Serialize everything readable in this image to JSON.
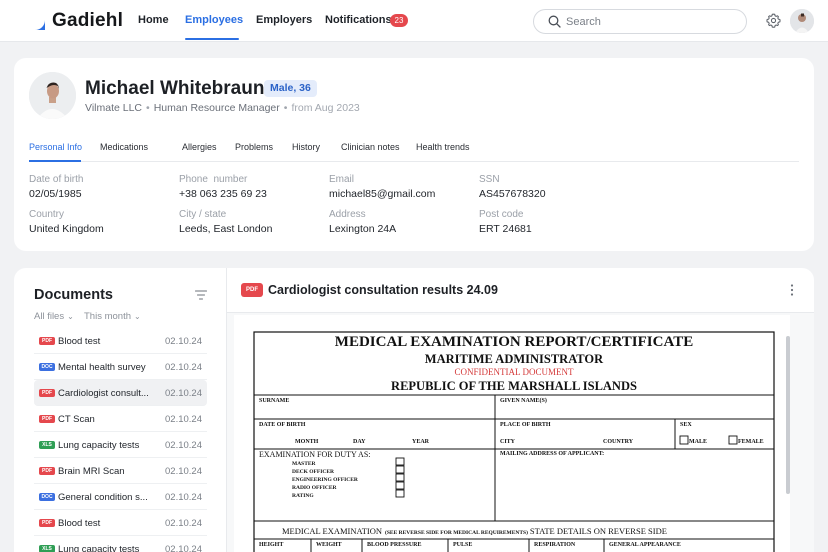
{
  "app": {
    "brand": "Gadiehl",
    "nav": [
      {
        "label": "Home"
      },
      {
        "label": "Employees"
      },
      {
        "label": "Employers"
      },
      {
        "label": "Notifications"
      }
    ],
    "notifications_count": "23",
    "search_placeholder": "Search",
    "accent": "#2b6fe3"
  },
  "profile": {
    "name": "Michael Whitebraun",
    "badge": "Male, 36",
    "company": "Vilmate LLC",
    "role": "Human Resource Manager",
    "since": "from Aug 2023",
    "tabs": [
      "Personal Info",
      "Medications",
      "Allergies",
      "Problems",
      "History",
      "Clinician notes",
      "Health trends"
    ],
    "fields": [
      {
        "label": "Date of birth",
        "value": "02/05/1985"
      },
      {
        "label": "Phone  number",
        "value": "+38 063 235 69 23"
      },
      {
        "label": "Email",
        "value": "michael85@gmail.com"
      },
      {
        "label": "SSN",
        "value": "AS457678320"
      },
      {
        "label": "Country",
        "value": "United Kingdom"
      },
      {
        "label": "City / state",
        "value": "Leeds, East London"
      },
      {
        "label": "Address",
        "value": "Lexington 24A"
      },
      {
        "label": "Post code",
        "value": "ERT 24681"
      }
    ]
  },
  "documents": {
    "title": "Documents",
    "filter_files": "All files",
    "filter_period": "This month",
    "items": [
      {
        "type": "PDF",
        "name": "Blood test",
        "date": "02.10.24"
      },
      {
        "type": "DOC",
        "name": "Mental health survey",
        "date": "02.10.24"
      },
      {
        "type": "PDF",
        "name": "Cardiologist consult...",
        "date": "02.10.24"
      },
      {
        "type": "PDF",
        "name": "CT Scan",
        "date": "02.10.24"
      },
      {
        "type": "XLS",
        "name": "Lung capacity tests",
        "date": "02.10.24"
      },
      {
        "type": "PDF",
        "name": "Brain MRI Scan",
        "date": "02.10.24"
      },
      {
        "type": "DOC",
        "name": "General condition s...",
        "date": "02.10.24"
      },
      {
        "type": "PDF",
        "name": "Blood test",
        "date": "02.10.24"
      },
      {
        "type": "XLS",
        "name": "Lung capacity tests",
        "date": "02.10.24"
      }
    ],
    "type_colors": {
      "PDF": "#e5484d",
      "DOC": "#3b6fe0",
      "XLS": "#2f9e55"
    }
  },
  "viewer": {
    "file_type": "PDF",
    "title": "Cardiologist consultation results 24.09",
    "form": {
      "heading": "MEDICAL EXAMINATION REPORT/CERTIFICATE",
      "subheading": "MARITIME ADMINISTRATOR",
      "confidential": "CONFIDENTIAL DOCUMENT",
      "republic": "REPUBLIC OF THE MARSHALL ISLANDS",
      "surname": "SURNAME",
      "given_names": "GIVEN NAME(S)",
      "date_of_birth": "DATE OF BIRTH",
      "place_of_birth": "PLACE OF BIRTH",
      "sex": "SEX",
      "month": "MONTH",
      "day": "DAY",
      "year": "YEAR",
      "city": "CITY",
      "country": "COUNTRY",
      "male": "MALE",
      "female": "FEMALE",
      "exam_for_duty": "EXAMINATION FOR DUTY AS:",
      "duties": [
        "MASTER",
        "DECK OFFICER",
        "ENGINEERING OFFICER",
        "RADIO OFFICER",
        "RATING"
      ],
      "mailing_address": "MAILING ADDRESS OF APPLICANT:",
      "medical_exam_a": "MEDICAL EXAMINATION",
      "medical_exam_b": "(SEE REVERSE SIDE FOR MEDICAL REQUIREMENTS)",
      "medical_exam_c": "STATE DETAILS ON REVERSE SIDE",
      "vitals": [
        "HEIGHT",
        "WEIGHT",
        "BLOOD PRESSURE",
        "PULSE",
        "RESPIRATION",
        "GENERAL APPEARANCE"
      ]
    }
  }
}
